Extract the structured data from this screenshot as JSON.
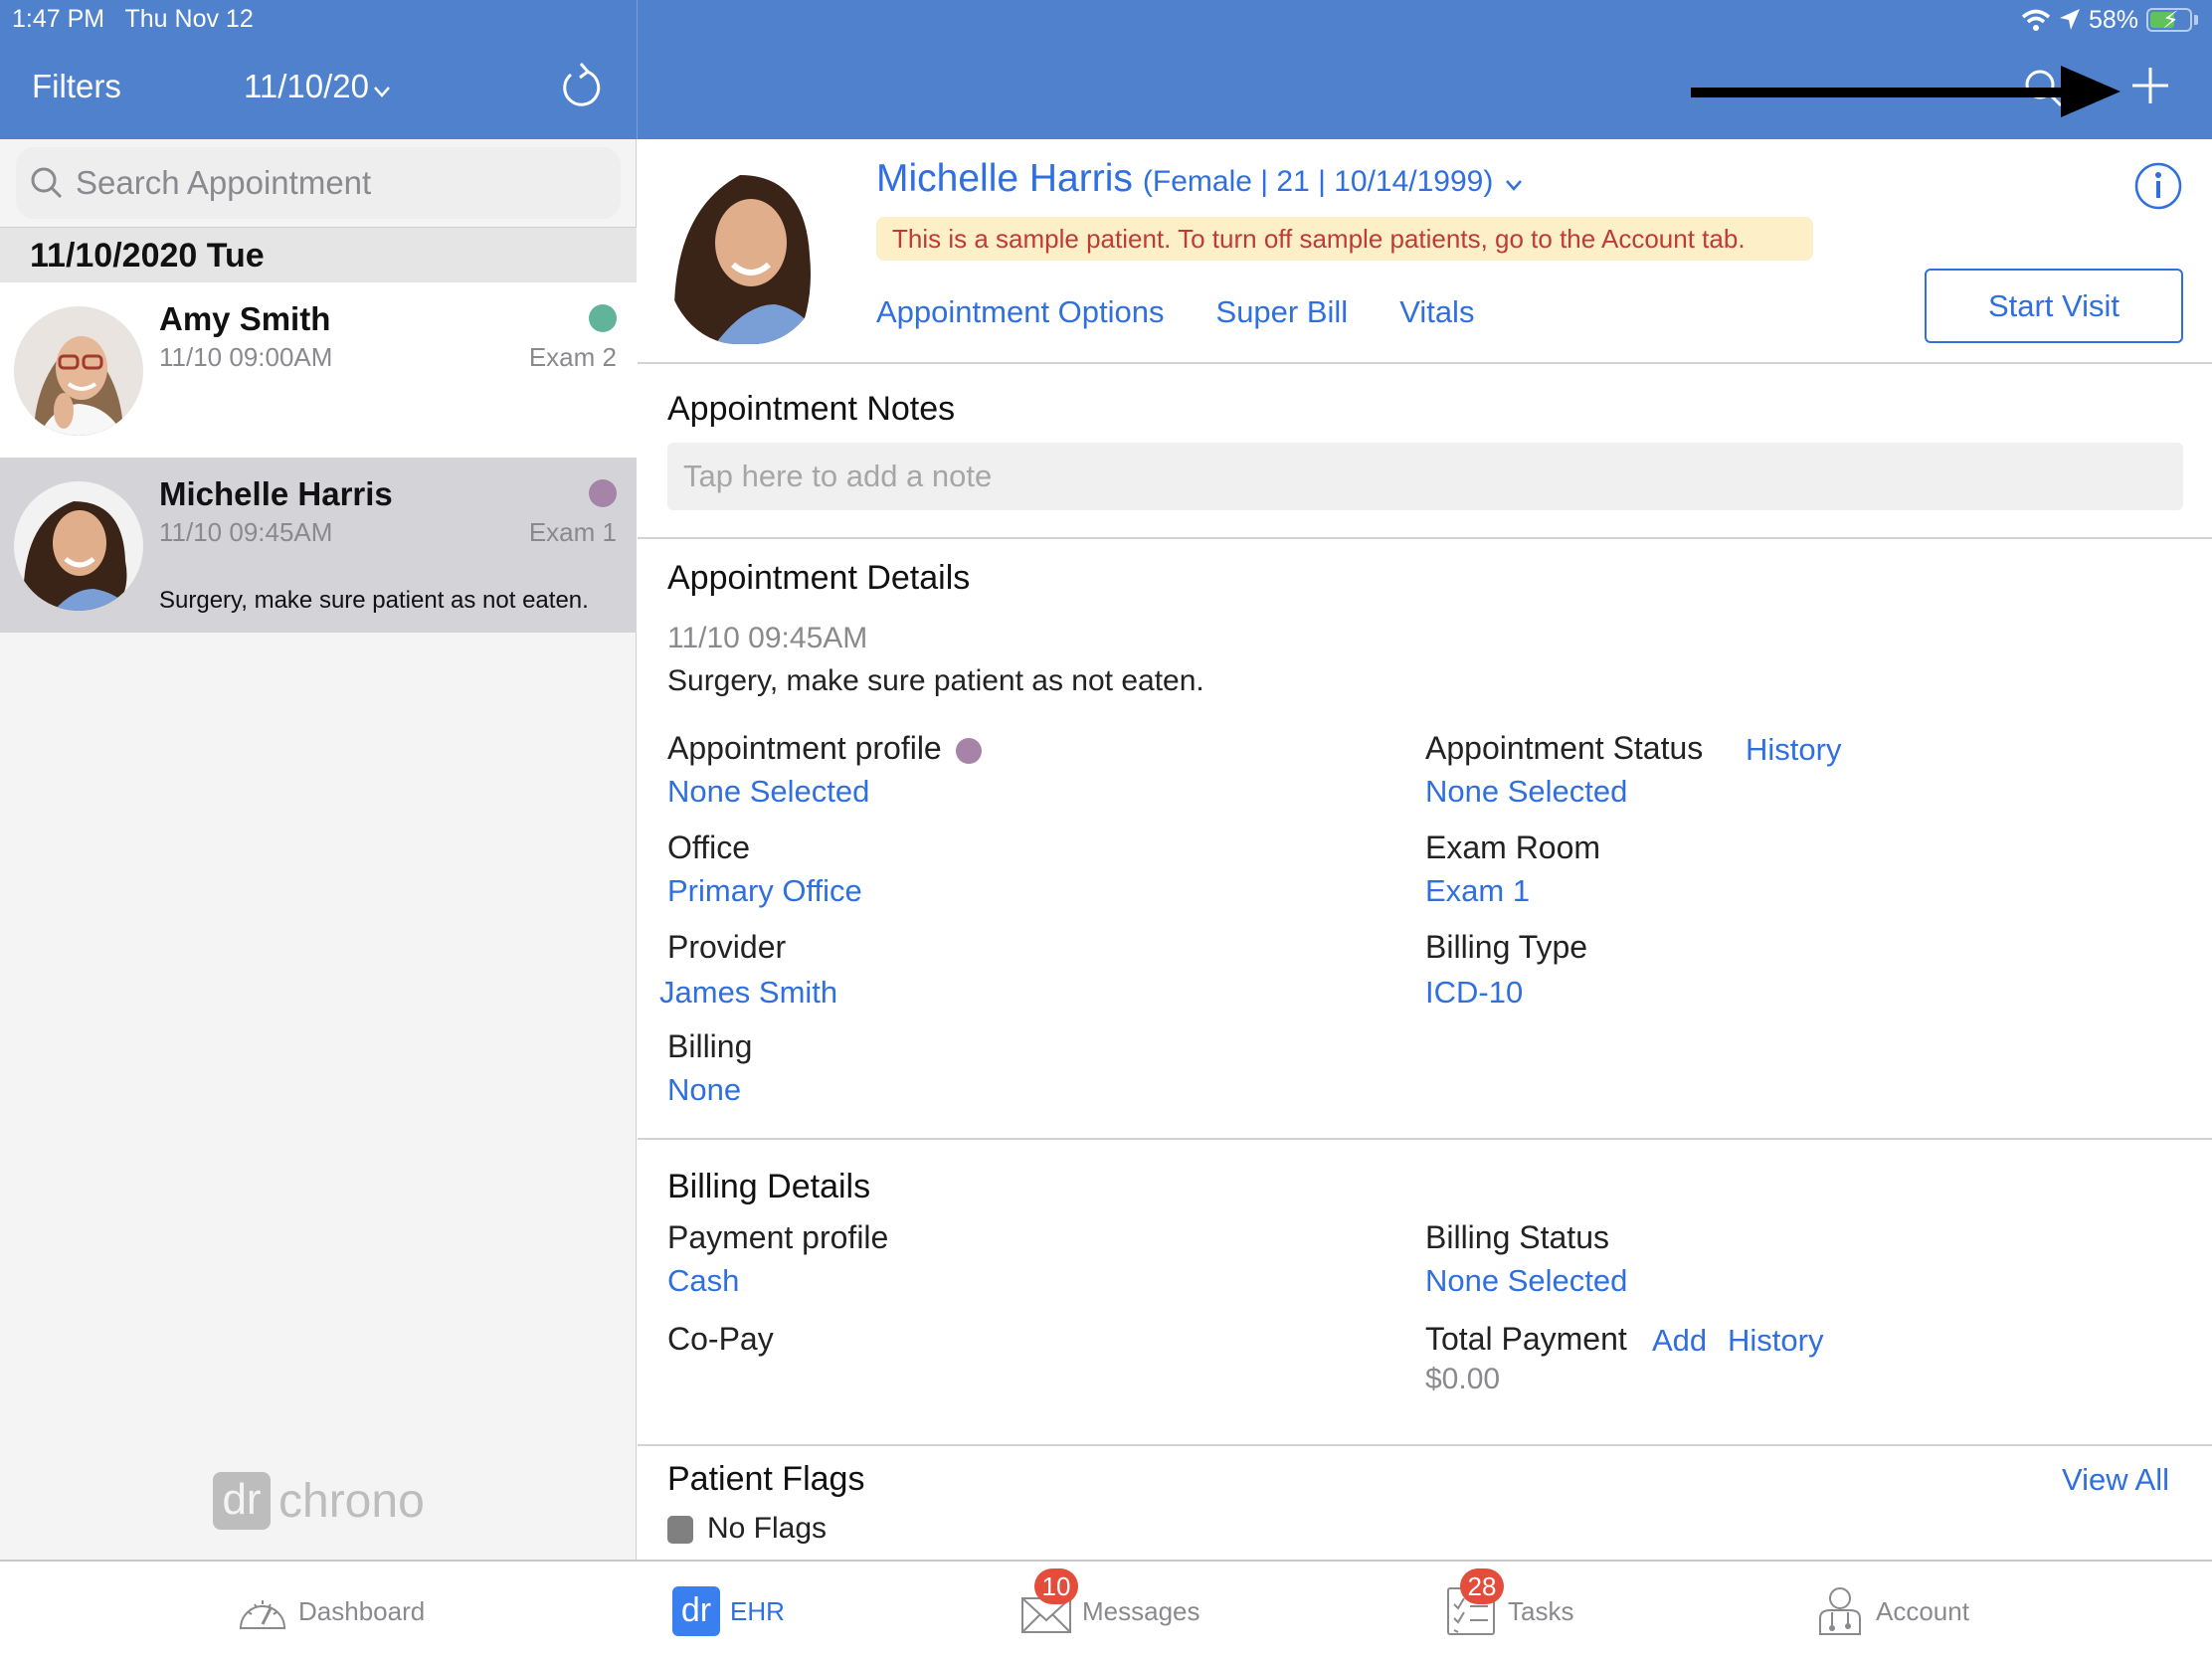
{
  "status_bar": {
    "time": "1:47 PM",
    "date": "Thu Nov 12",
    "battery": "58%",
    "battery_level": 0.58
  },
  "nav": {
    "filters_label": "Filters",
    "date_value": "11/10/20",
    "chevron": "⌄",
    "icons": [
      "refresh-icon",
      "search-icon",
      "plus-icon"
    ],
    "annotation": "arrow pointing to add (+) button"
  },
  "sidebar": {
    "search_placeholder": "Search Appointment",
    "date_header": "11/10/2020 Tue",
    "appointments": [
      {
        "name": "Amy Smith",
        "time": "11/10 09:00AM",
        "room": "Exam 2",
        "status_color": "#61b49a",
        "note": "",
        "selected": false
      },
      {
        "name": "Michelle Harris",
        "time": "11/10 09:45AM",
        "room": "Exam 1",
        "status_color": "#a684a8",
        "note": "Surgery, make sure patient as not eaten.",
        "selected": true
      }
    ],
    "logo": {
      "mark": "dr",
      "word": "chrono"
    }
  },
  "patient": {
    "name": "Michelle Harris",
    "demographics": "(Female | 21 | 10/14/1999)",
    "chevron": "⌄",
    "sample_banner": "This is a sample patient. To turn off sample patients, go to the Account tab.",
    "actions": [
      "Appointment Options",
      "Super Bill",
      "Vitals"
    ],
    "start_visit_label": "Start Visit"
  },
  "notes": {
    "title": "Appointment Notes",
    "placeholder": "Tap here to add a note"
  },
  "details": {
    "title": "Appointment Details",
    "datetime": "11/10 09:45AM",
    "reason": "Surgery, make sure patient as not eaten.",
    "appointment_profile": {
      "label": "Appointment profile",
      "value": "None Selected",
      "dot_color": "#a684a8"
    },
    "appointment_status": {
      "label": "Appointment Status",
      "link": "History",
      "value": "None Selected"
    },
    "office": {
      "label": "Office",
      "value": "Primary Office"
    },
    "exam_room": {
      "label": "Exam Room",
      "value": "Exam 1"
    },
    "provider": {
      "label": "Provider",
      "value": "James Smith"
    },
    "billing_type": {
      "label": "Billing Type",
      "value": "ICD-10"
    },
    "billing": {
      "label": "Billing",
      "value": "None"
    }
  },
  "billing_details": {
    "title": "Billing Details",
    "payment_profile": {
      "label": "Payment profile",
      "value": "Cash"
    },
    "billing_status": {
      "label": "Billing Status",
      "value": "None Selected"
    },
    "copay": {
      "label": "Co-Pay"
    },
    "total_payment": {
      "label": "Total Payment",
      "add_link": "Add",
      "history_link": "History",
      "value": "$0.00"
    }
  },
  "flags": {
    "title": "Patient Flags",
    "view_all": "View All",
    "item": "No Flags"
  },
  "tabbar": {
    "tabs": [
      {
        "label": "Dashboard",
        "icon": "speedometer-icon",
        "badge": ""
      },
      {
        "label": "EHR",
        "icon": "dr-logo-icon",
        "badge": "",
        "active": true
      },
      {
        "label": "Messages",
        "icon": "envelope-icon",
        "badge": "10"
      },
      {
        "label": "Tasks",
        "icon": "checklist-icon",
        "badge": "28"
      },
      {
        "label": "Account",
        "icon": "doctor-icon",
        "badge": ""
      }
    ],
    "ehr_mark": "dr"
  },
  "colors": {
    "nav_blue": "#4f81cd",
    "link_blue": "#2f6fde",
    "badge_red": "#e44c3c",
    "banner_bg": "#fdf0c9",
    "banner_text": "#c03a36"
  }
}
